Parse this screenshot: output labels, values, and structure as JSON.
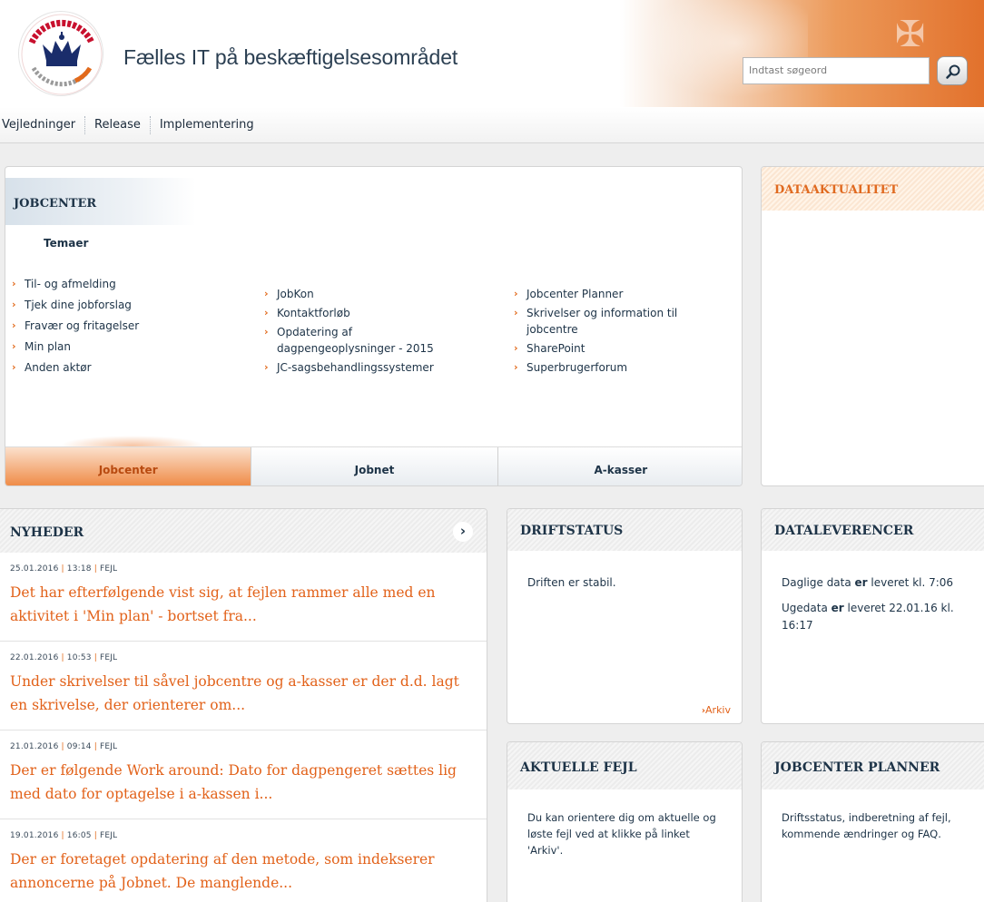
{
  "header": {
    "logo_alt": "ARBEIDSMARKED REKRUTTERING",
    "site_title": "Fælles IT på beskæftigelsesområdet",
    "search_placeholder": "Indtast søgeord"
  },
  "nav": {
    "items": [
      "Vejledninger",
      "Release",
      "Implementering"
    ]
  },
  "jobcenter": {
    "title": "JOBCENTER",
    "subtitle": "Temaer",
    "col1": [
      "Til- og afmelding",
      "Tjek dine jobforslag",
      "Fravær og fritagelser",
      "Min plan",
      "Anden aktør"
    ],
    "col2": [
      "JobKon",
      "Kontaktforløb",
      "Opdatering af dagpengeoplysninger - 2015",
      "JC-sagsbehandlingssystemer"
    ],
    "col3": [
      "Jobcenter Planner",
      "Skrivelser og information til jobcentre",
      "SharePoint",
      "Superbrugerforum"
    ],
    "tabs": [
      "Jobcenter",
      "Jobnet",
      "A-kasser"
    ],
    "active_tab": "Jobcenter"
  },
  "dataaktualitet": {
    "title": "DATAAKTUALITET"
  },
  "nyheder": {
    "title": "NYHEDER",
    "items": [
      {
        "date": "25.01.2016",
        "time": "13:18",
        "tag": "FEJL",
        "text": "Det har efterfølgende vist sig, at fejlen rammer alle med en aktivitet i 'Min plan' - bortset fra..."
      },
      {
        "date": "22.01.2016",
        "time": "10:53",
        "tag": "FEJL",
        "text": "Under skrivelser til såvel jobcentre og a-kasser er der d.d. lagt en skrivelse, der orienterer om..."
      },
      {
        "date": "21.01.2016",
        "time": "09:14",
        "tag": "FEJL",
        "text": "Der er følgende Work around: Dato for dagpengeret sættes lig med dato for optagelse i a-kassen i..."
      },
      {
        "date": "19.01.2016",
        "time": "16:05",
        "tag": "FEJL",
        "text": "Der er foretaget opdatering af den metode, som indekserer annoncerne på Jobnet. De manglende..."
      }
    ]
  },
  "driftstatus": {
    "title": "DRIFTSTATUS",
    "text": "Driften er stabil.",
    "archive_label": "Arkiv"
  },
  "dataleverencer": {
    "title": "DATALEVERENCER",
    "daily_prefix": "Daglige data ",
    "daily_bold": "er",
    "daily_suffix": " leveret kl. 7:06",
    "weekly_prefix": "Ugedata ",
    "weekly_bold": "er",
    "weekly_suffix": " leveret 22.01.16 kl. 16:17"
  },
  "aktuelle_fejl": {
    "title": "AKTUELLE FEJL",
    "text": "Du kan orientere dig om aktuelle og løste fejl ved at klikke på linket 'Arkiv'."
  },
  "jobcenter_planner": {
    "title": "JOBCENTER PLANNER",
    "text": "Driftsstatus, indberetning af fejl, kommende ændringer og FAQ."
  },
  "colors": {
    "accent": "#e2621a",
    "navy": "#1d3347"
  }
}
